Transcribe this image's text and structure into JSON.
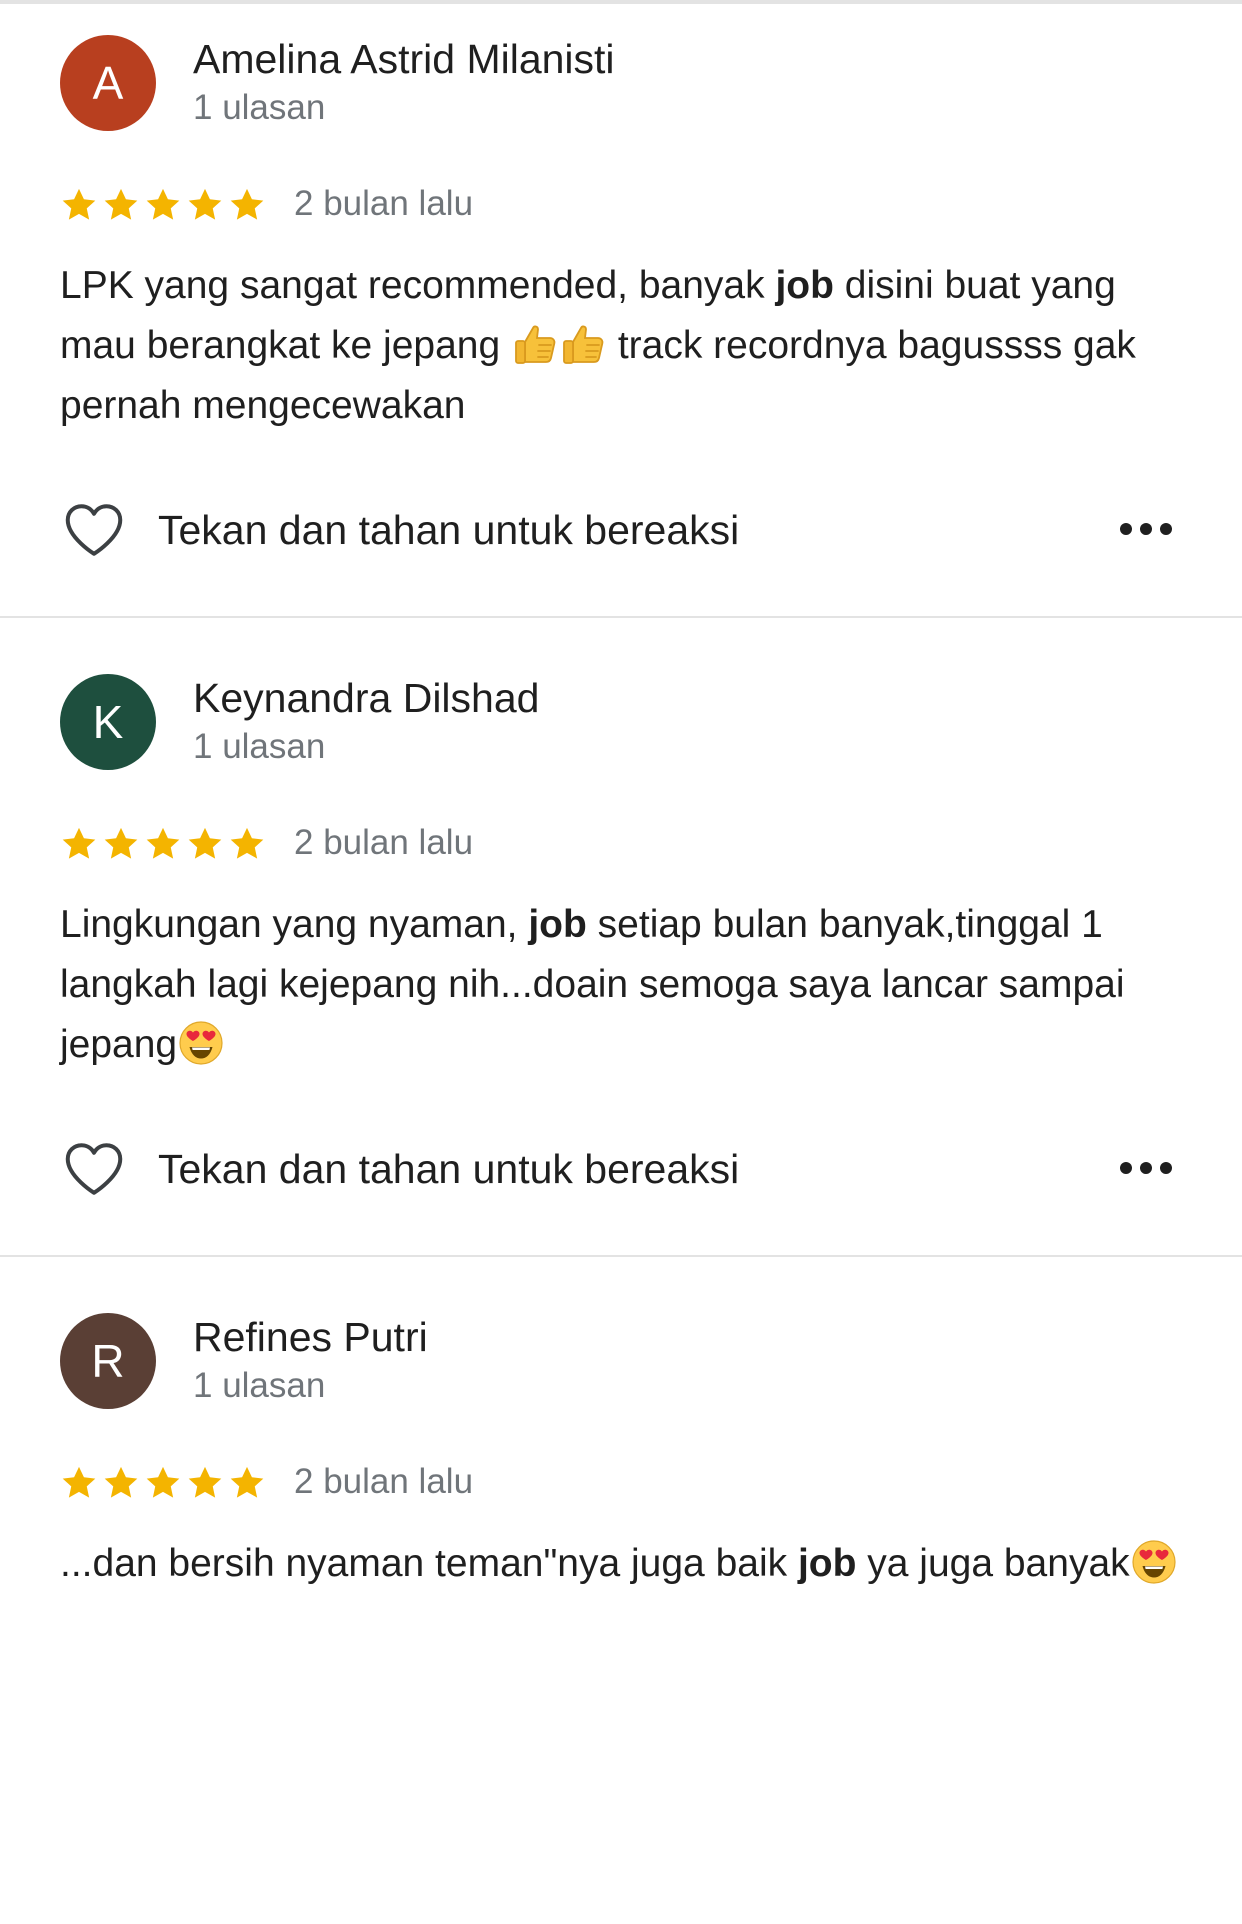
{
  "reviews": [
    {
      "initial": "A",
      "avatar_color": "#b83f1f",
      "author": "Amelina Astrid Milanisti",
      "meta": "1 ulasan",
      "rating": 5,
      "time": "2 bulan lalu",
      "text": {
        "t1": "LPK yang sangat recommended, banyak ",
        "b1": "job",
        "t2": " disini buat yang mau berangkat ke jepang ",
        "emoji1": "thumbs-up",
        "emoji2": "thumbs-up",
        "t3": " track recordnya bagussss gak pernah mengecewakan"
      },
      "react_label": "Tekan dan tahan untuk bereaksi"
    },
    {
      "initial": "K",
      "avatar_color": "#1e4f3e",
      "author": "Keynandra Dilshad",
      "meta": "1 ulasan",
      "rating": 5,
      "time": "2 bulan lalu",
      "text": {
        "t1": "Lingkungan yang nyaman, ",
        "b1": "job",
        "t2": " setiap bulan banyak,tinggal 1 langkah lagi kejepang nih...doain semoga saya lancar sampai jepang",
        "emoji1": "heart-eyes"
      },
      "react_label": "Tekan dan tahan untuk bereaksi"
    },
    {
      "initial": "R",
      "avatar_color": "#5a3f35",
      "author": "Refines Putri",
      "meta": "1 ulasan",
      "rating": 5,
      "time": "2 bulan lalu",
      "text": {
        "t1": "...dan bersih nyaman teman\"nya juga baik ",
        "b1": "job",
        "t2": " ya juga banyak",
        "emoji1": "heart-eyes"
      }
    }
  ],
  "colors": {
    "star": "#f4b400",
    "divider": "#e3e3e3",
    "secondary_text": "#70757a"
  }
}
